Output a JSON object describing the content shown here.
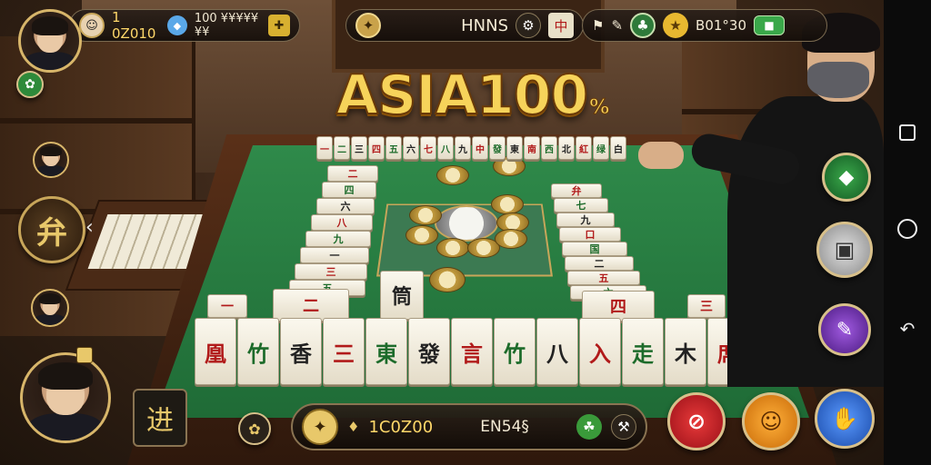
{
  "game": {
    "logo": "ASIA100",
    "logo_suffix": "%"
  },
  "top_left_bar": {
    "coins": "1 0Z010",
    "gems": "100 ¥¥¥¥¥¥¥"
  },
  "top_center_bar": {
    "label": "HNNS"
  },
  "top_right_bar": {
    "score": "B01°30"
  },
  "bottom_bar": {
    "balance": "1C0Z00",
    "bet": "EN54§"
  },
  "side_left": {
    "big_tile_label": "弁",
    "chat_tile_label": "进"
  },
  "colors": {
    "felt": "#2f8a4a",
    "gold": "#f6d35a",
    "red_btn": "#c8202a",
    "orange_btn": "#e88a1a",
    "blue_btn": "#2a6ad0",
    "green_btn": "#1e7a3a",
    "purple_btn": "#7a3ab0"
  },
  "icons": {
    "settings": "gear-icon",
    "back": "back-arrow-icon",
    "home": "home-circle-icon",
    "recents": "square-icon"
  },
  "tiles": {
    "far_row": [
      "一",
      "二",
      "三",
      "四",
      "五",
      "六",
      "七",
      "八",
      "九",
      "中",
      "發",
      "東",
      "南",
      "西",
      "北",
      "紅",
      "绿",
      "白"
    ],
    "near_row": [
      "凰",
      "竹",
      "香",
      "三",
      "東",
      "發",
      "言",
      "竹",
      "八",
      "入",
      "走",
      "木",
      "席"
    ],
    "left_col": [
      "二",
      "四",
      "六",
      "八",
      "九",
      "一",
      "三",
      "五"
    ],
    "right_col": [
      "弁",
      "七",
      "九",
      "口",
      "国",
      "二",
      "五",
      "六"
    ]
  }
}
